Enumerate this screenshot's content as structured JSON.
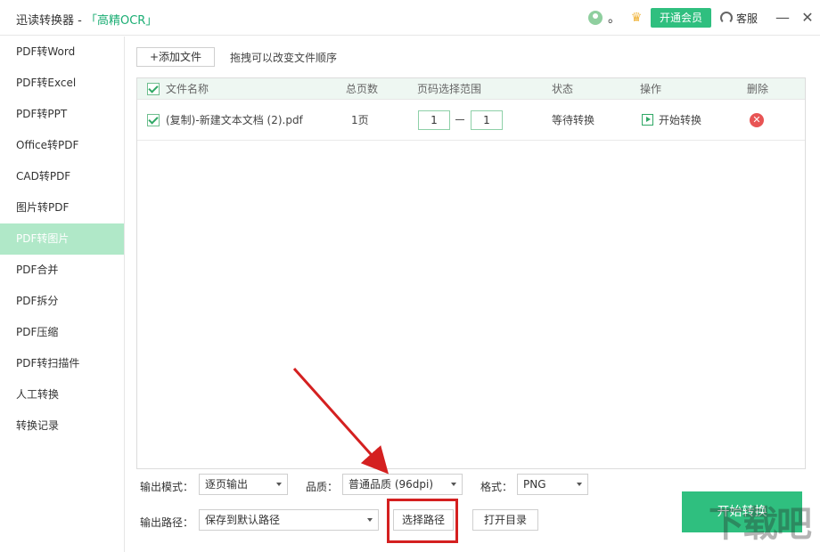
{
  "titlebar": {
    "app_name": "迅读转换器 - ",
    "app_sub": "「高精OCR」",
    "user_dot": "。",
    "vip_label": "开通会员",
    "service_label": "客服",
    "minimize": "—",
    "close": "✕"
  },
  "sidebar": {
    "items": [
      {
        "label": "PDF转Word"
      },
      {
        "label": "PDF转Excel"
      },
      {
        "label": "PDF转PPT"
      },
      {
        "label": "Office转PDF"
      },
      {
        "label": "CAD转PDF"
      },
      {
        "label": "图片转PDF"
      },
      {
        "label": "PDF转图片"
      },
      {
        "label": "PDF合并"
      },
      {
        "label": "PDF拆分"
      },
      {
        "label": "PDF压缩"
      },
      {
        "label": "PDF转扫描件"
      },
      {
        "label": "人工转换"
      },
      {
        "label": "转换记录"
      }
    ],
    "active_index": 6
  },
  "toolbar": {
    "add_file": "+添加文件",
    "drag_tip": "拖拽可以改变文件顺序"
  },
  "table": {
    "headers": {
      "filename": "文件名称",
      "pages": "总页数",
      "range": "页码选择范围",
      "status": "状态",
      "action": "操作",
      "delete": "删除"
    },
    "rows": [
      {
        "filename": "(复制)-新建文本文档 (2).pdf",
        "pages": "1页",
        "range_from": "1",
        "range_to": "1",
        "status": "等待转换",
        "action": "开始转换"
      }
    ]
  },
  "settings": {
    "mode_label": "输出模式：",
    "mode_value": "逐页输出",
    "quality_label": "品质：",
    "quality_value": "普通品质 (96dpi)",
    "format_label": "格式：",
    "format_value": "PNG",
    "path_label": "输出路径：",
    "path_value": "保存到默认路径",
    "choose_path": "选择路径",
    "open_dir": "打开目录",
    "start": "开始转换"
  },
  "colors": {
    "accent": "#2fbf7f",
    "active_sidebar": "#b0e8c8",
    "highlight": "#d42020"
  }
}
